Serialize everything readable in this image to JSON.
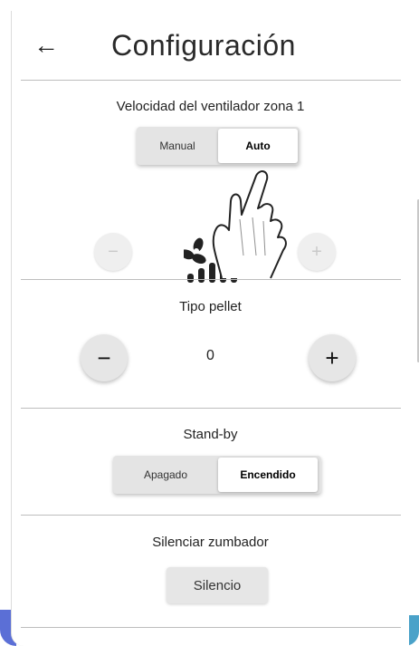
{
  "header": {
    "title": "Configuración",
    "back_icon": "arrow-left-icon"
  },
  "fan_zone": {
    "title": "Velocidad del ventilador zona 1",
    "modes": [
      "Manual",
      "Auto"
    ],
    "active_mode": "Auto",
    "minus": "−",
    "plus": "+",
    "icon": "fan-icon",
    "speed_levels": 5
  },
  "pellet": {
    "title": "Tipo pellet",
    "value": "0",
    "minus": "−",
    "plus": "+"
  },
  "standby": {
    "title": "Stand-by",
    "options": [
      "Apagado",
      "Encendido"
    ],
    "active": "Encendido"
  },
  "buzzer": {
    "title": "Silenciar zumbador",
    "button_label": "Silencio"
  },
  "colors": {
    "accent_left": "#5b6fd6",
    "accent_right": "#4aa2c9",
    "divider": "#bdbdbd"
  }
}
